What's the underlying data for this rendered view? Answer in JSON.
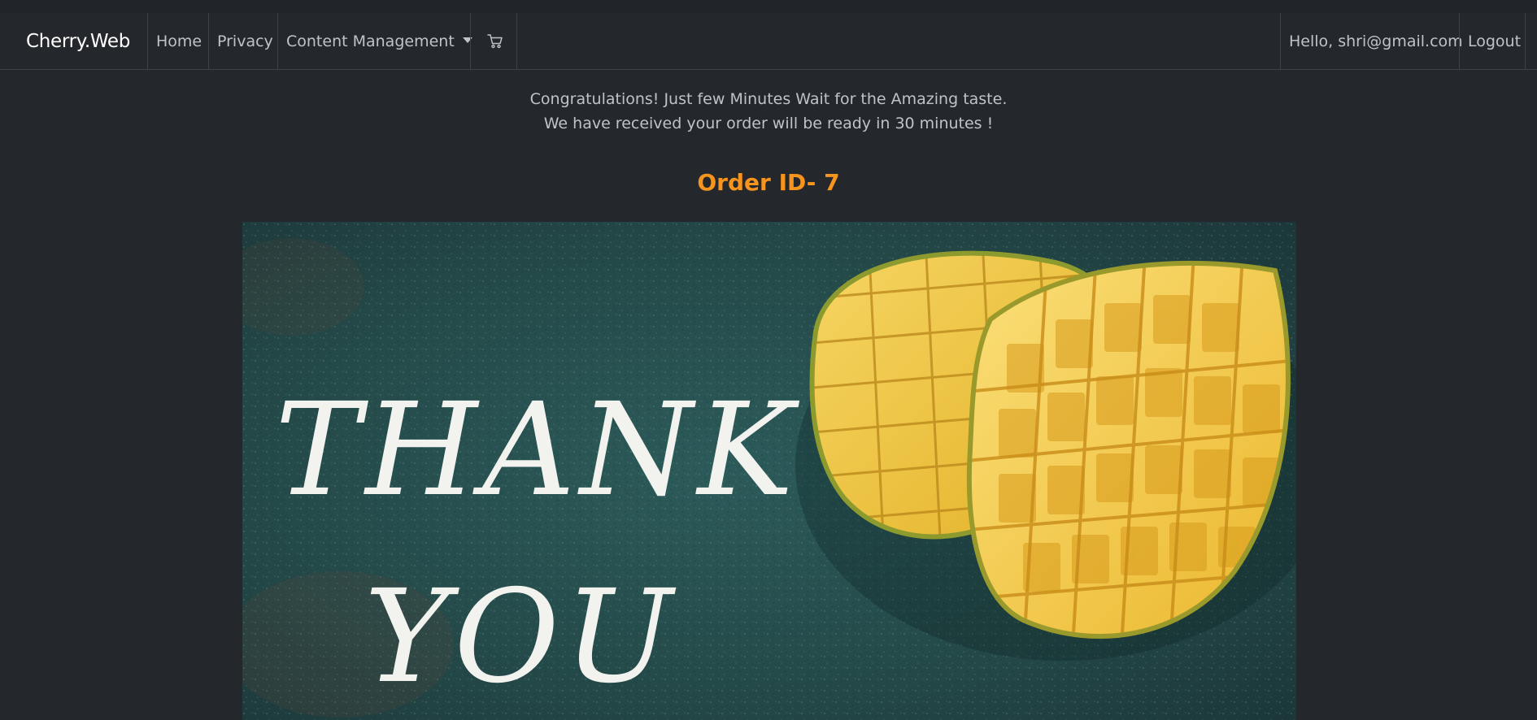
{
  "navbar": {
    "brand": "Cherry.Web",
    "links": [
      {
        "label": "Home"
      },
      {
        "label": "Privacy"
      },
      {
        "label": "Content Management",
        "has_dropdown": true
      }
    ],
    "cart_icon": "shopping-cart-icon",
    "greeting": "Hello, shri@gmail.com",
    "logout_label": "Logout"
  },
  "main": {
    "message_line1": "Congratulations! Just few Minutes Wait for the Amazing taste.",
    "message_line2": "We have received your order will be ready in 30 minutes !",
    "order_id_text": "Order ID- 7",
    "banner": {
      "line1": "THANK",
      "line2": "YOU"
    }
  },
  "colors": {
    "page_bg": "#24272b",
    "text_muted": "#bfc3c7",
    "accent_orange": "#f7941d",
    "banner_bg": "#2f5a5a",
    "mango_yellow": "#f2c744"
  }
}
